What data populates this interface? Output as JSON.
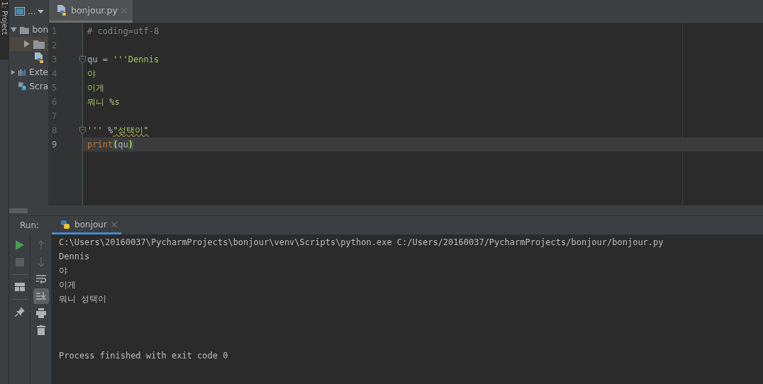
{
  "tool_strip": {
    "label": "1: Project"
  },
  "project": {
    "toolbar_label": "...",
    "tree": [
      {
        "label": "bon",
        "kind": "folder",
        "expanded": true,
        "selected": false,
        "children": [
          {
            "kind": "folder",
            "expanded": false,
            "selected": true
          },
          {
            "kind": "python-file",
            "selected": false
          }
        ]
      },
      {
        "label": "Exte",
        "kind": "libraries",
        "expanded": false,
        "selected": false
      },
      {
        "label": "Scra",
        "kind": "scratches",
        "selected": false
      }
    ]
  },
  "editor": {
    "tabs": [
      {
        "label": "bonjour.py",
        "selected": true
      }
    ],
    "lines": [
      {
        "number": "1",
        "current": false,
        "tokens": [
          {
            "text": "# coding=utf-8",
            "kind": "comment"
          }
        ]
      },
      {
        "number": "2",
        "current": false
      },
      {
        "number": "3",
        "fold": true,
        "current": false,
        "tokens": [
          {
            "text": "qu = ",
            "kind": "plain"
          },
          {
            "text": "'''Dennis",
            "kind": "string"
          }
        ]
      },
      {
        "number": "4",
        "current": false,
        "tokens": [
          {
            "text": "야",
            "kind": "string"
          }
        ]
      },
      {
        "number": "5",
        "current": false,
        "tokens": [
          {
            "text": "이게",
            "kind": "string"
          }
        ]
      },
      {
        "number": "6",
        "current": false,
        "tokens": [
          {
            "text": "뭐니 %s",
            "kind": "string"
          }
        ]
      },
      {
        "number": "7",
        "current": false
      },
      {
        "number": "8",
        "fold": true,
        "current": false,
        "tokens": [
          {
            "text": "''' ",
            "kind": "string"
          },
          {
            "text": "%",
            "kind": "plain"
          },
          {
            "text": "\"성택이\"",
            "kind": "typo"
          }
        ]
      },
      {
        "number": "9",
        "current": true,
        "tokens": [
          {
            "text": "print",
            "kind": "builtin"
          },
          {
            "text": "(",
            "kind": "brace"
          },
          {
            "text": "qu",
            "kind": "plain"
          },
          {
            "text": ")",
            "kind": "brace"
          }
        ]
      }
    ]
  },
  "run": {
    "label": "Run:",
    "tabs": [
      {
        "label": "bonjour",
        "selected": true
      }
    ],
    "tools_left": [
      {
        "kind": "run",
        "disabled": false
      },
      {
        "kind": "stop",
        "disabled": true
      },
      {
        "kind": "layout",
        "disabled": false
      },
      {
        "kind": "pin",
        "disabled": false
      }
    ],
    "tools_right": [
      {
        "kind": "up",
        "disabled": true,
        "selected": false
      },
      {
        "kind": "down",
        "disabled": true,
        "selected": false
      },
      {
        "kind": "wrap",
        "disabled": false,
        "selected": false
      },
      {
        "kind": "scroll-end",
        "disabled": false,
        "selected": true
      },
      {
        "kind": "print",
        "disabled": false,
        "selected": false
      },
      {
        "kind": "trash",
        "disabled": false,
        "selected": false
      }
    ],
    "output": [
      {
        "text": "C:\\Users\\20160037\\PycharmProjects\\bonjour\\venv\\Scripts\\python.exe C:/Users/20160037/PycharmProjects/bonjour/bonjour.py",
        "kind": "command"
      },
      {
        "text": "Dennis",
        "kind": "stdout"
      },
      {
        "text": "야",
        "kind": "stdout"
      },
      {
        "text": "이게",
        "kind": "stdout"
      },
      {
        "text": "뭐니 성택이",
        "kind": "stdout"
      },
      {
        "text": "Process finished with exit code 0",
        "kind": "exit"
      }
    ]
  }
}
